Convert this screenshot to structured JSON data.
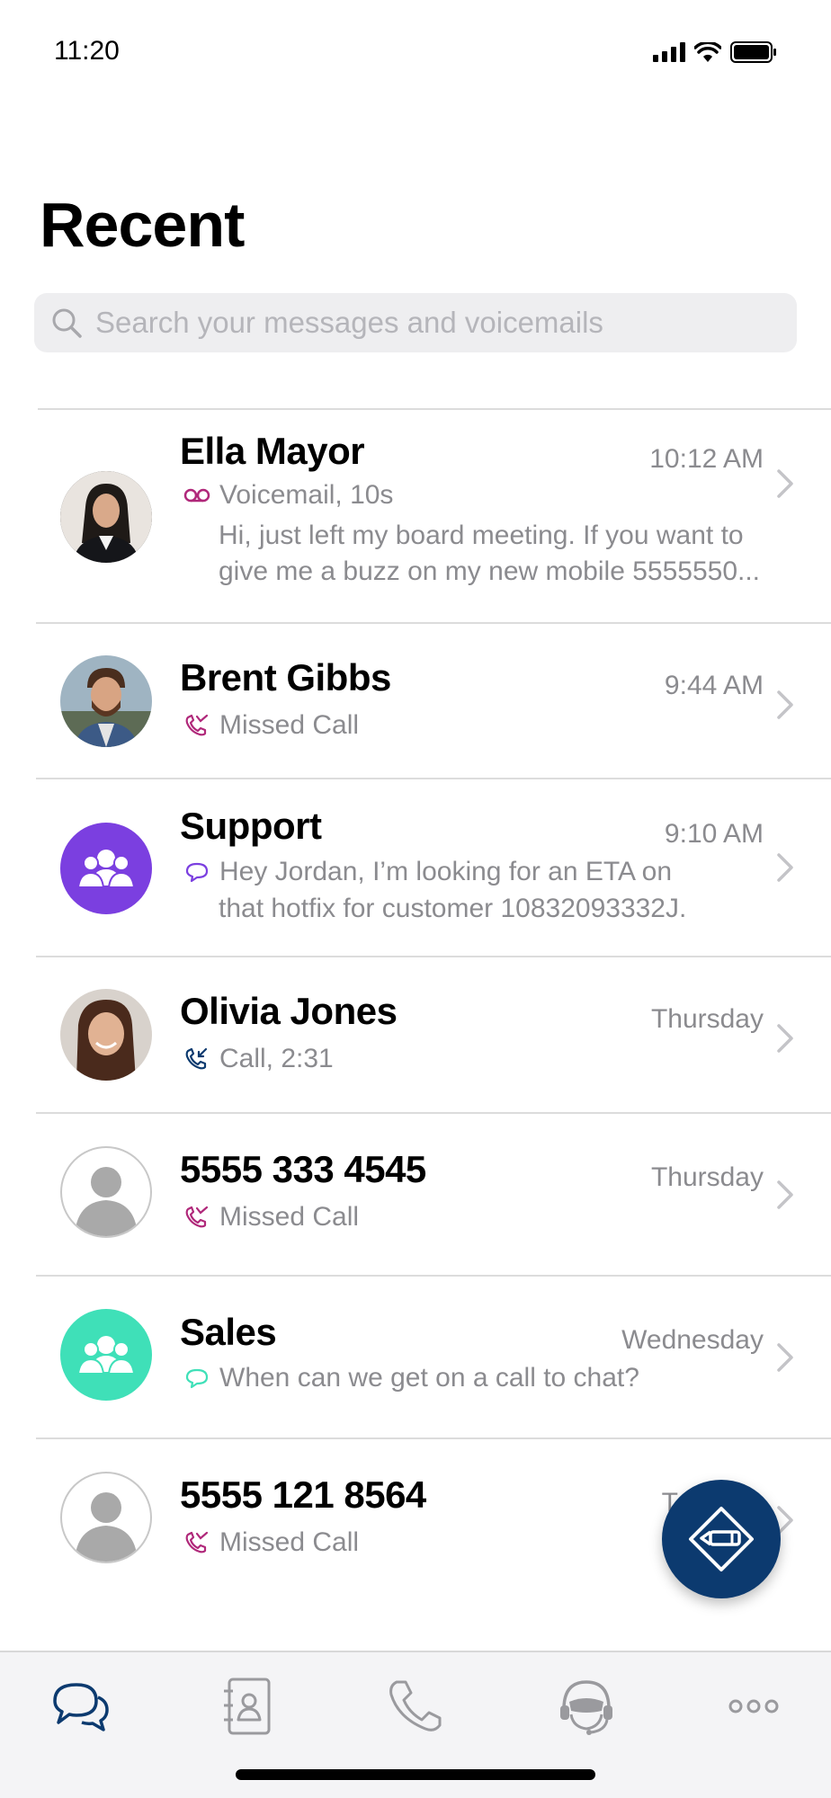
{
  "status_bar": {
    "time": "11:20"
  },
  "page_title": "Recent",
  "search": {
    "placeholder": "Search your messages and voicemails"
  },
  "rows": [
    {
      "name": "Ella Mayor",
      "time": "10:12 AM",
      "type": "voicemail",
      "subtitle": "Voicemail, 10s",
      "preview": "Hi, just left my board meeting. If you want to give me a buzz on my new mobile 5555550...",
      "avatar": "photo",
      "icon": "voicemail-icon"
    },
    {
      "name": "Brent Gibbs",
      "time": "9:44 AM",
      "type": "missed",
      "subtitle": "Missed Call",
      "avatar": "photo",
      "icon": "missed-call-icon"
    },
    {
      "name": "Support",
      "time": "9:10 AM",
      "type": "message",
      "subtitle": "Hey Jordan,  I’m looking for an ETA on",
      "preview": "that hotfix for customer 10832093332J.",
      "avatar": "group",
      "avatar_color": "#7b3fe0",
      "icon": "chat-bubble-icon"
    },
    {
      "name": "Olivia Jones",
      "time": "Thursday",
      "type": "call",
      "subtitle": "Call, 2:31",
      "avatar": "photo",
      "icon": "incoming-call-icon"
    },
    {
      "name": "5555 333 4545",
      "time": "Thursday",
      "type": "missed",
      "subtitle": "Missed Call",
      "avatar": "placeholder",
      "icon": "missed-call-icon"
    },
    {
      "name": "Sales",
      "time": "Wednesday",
      "type": "message",
      "subtitle": "When can we get on a call to chat?",
      "avatar": "group",
      "avatar_color": "#3fe0b8",
      "icon": "chat-bubble-icon"
    },
    {
      "name": "5555 121 8564",
      "time": "T",
      "type": "missed",
      "subtitle": "Missed Call",
      "avatar": "placeholder",
      "icon": "missed-call-icon"
    }
  ],
  "colors": {
    "accent": "#0c3a6f",
    "missed": "#b0287a",
    "support": "#7b3fe0",
    "sales": "#3fe0b8",
    "secondary_text": "#8b8b8f"
  },
  "tabs": [
    "messages-tab",
    "contacts-tab",
    "calls-tab",
    "headset-tab",
    "more-tab"
  ],
  "fab": {
    "icon": "compose-icon"
  }
}
